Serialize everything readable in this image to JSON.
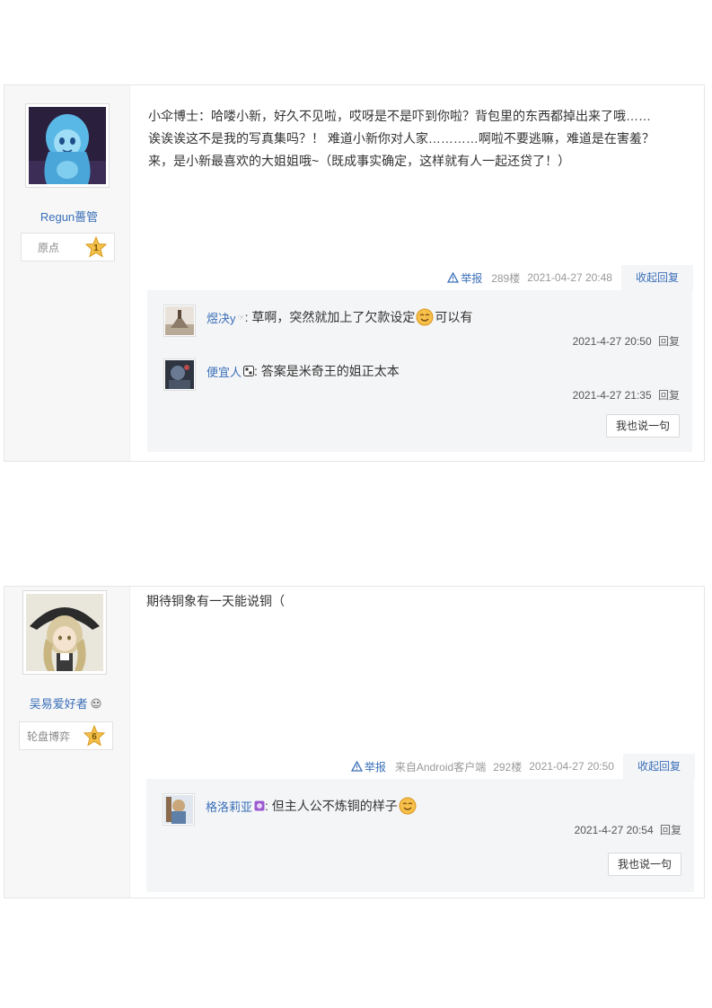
{
  "posts": [
    {
      "username": "Regun薔管",
      "rank_title": "原点",
      "rank_level": "1",
      "content_lines": [
        "小伞博士：哈喽小新，好久不见啦，哎呀是不是吓到你啦？背包里的东西都掉出来了哦……",
        "诶诶诶这不是我的写真集吗？！ 难道小新你对人家…………啊啦不要逃嘛，难道是在害羞？",
        "来，是小新最喜欢的大姐姐哦~（既成事实确定，这样就有人一起还贷了！）"
      ],
      "report_label": "举报",
      "client": "",
      "floor": "289楼",
      "time": "2021-04-27 20:48",
      "collapse_label": "收起回复",
      "replies": [
        {
          "name": "煜决y",
          "tag": "☞",
          "text": ": 草啊，突然就加上了欠款设定",
          "text_after": "可以有",
          "emoji": true,
          "time": "2021-4-27 20:50",
          "reply_label": "回复"
        },
        {
          "name": "便宜人",
          "tag": "",
          "text": ": 答案是米奇王的姐正太本",
          "text_after": "",
          "emoji": false,
          "time": "2021-4-27 21:35",
          "reply_label": "回复"
        }
      ],
      "say_label": "我也说一句"
    },
    {
      "username": "吴易爱好者",
      "rank_title": "轮盘博弈",
      "rank_level": "6",
      "content_lines": [
        "期待铜象有一天能说铜（"
      ],
      "report_label": "举报",
      "client": "来自Android客户端",
      "floor": "292楼",
      "time": "2021-04-27 20:50",
      "collapse_label": "收起回复",
      "replies": [
        {
          "name": "格洛莉亚",
          "tag": "",
          "text": ": 但主人公不炼铜的样子",
          "text_after": "",
          "emoji": true,
          "time": "2021-4-27 20:54",
          "reply_label": "回复"
        }
      ],
      "say_label": "我也说一句"
    }
  ],
  "icons": {
    "report": "warning-triangle-icon",
    "rank": "star-badge-icon",
    "emoji": "smile-emoji-icon"
  },
  "colors": {
    "link": "#3a6fb8",
    "star_gold": "#f3c14b",
    "panel": "#f4f5f7"
  }
}
